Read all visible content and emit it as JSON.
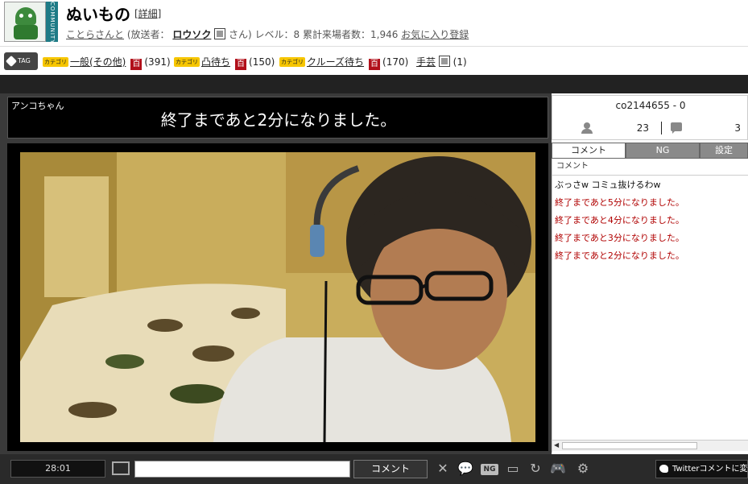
{
  "community": {
    "strip_text": "COMMUNITY",
    "title": "ぬいもの",
    "detail_link": "[詳細]",
    "community_name": "ことらさんと",
    "broadcaster_prefix": "(放送者：",
    "broadcaster_name": "ロウソク",
    "broadcaster_suffix": "さん)",
    "level": "レベル：8",
    "total_visitors": "累計来場者数：1,946",
    "favorite_link": "お気に入り登録"
  },
  "tags": {
    "label": "TAG",
    "items": [
      {
        "badge": "カテゴリ",
        "name": "一般(その他)",
        "dict": "百",
        "count": "(391)"
      },
      {
        "badge": "カテゴリ",
        "name": "凸待ち",
        "dict": "百",
        "count": "(150)"
      },
      {
        "badge": "カテゴリ",
        "name": "クルーズ待ち",
        "dict": "百",
        "count": "(170)"
      },
      {
        "badge": "",
        "name": "手芸",
        "dict": "",
        "count": "(1)"
      }
    ]
  },
  "telop": {
    "name": "アンコちゃん",
    "text": "終了まであと2分になりました。"
  },
  "stream": {
    "live_id": "co2144655 - 0",
    "viewers": "23",
    "comments": "3"
  },
  "tabs": [
    {
      "label": "コメント",
      "active": true
    },
    {
      "label": "NG",
      "active": false
    },
    {
      "label": "設定",
      "active": false
    }
  ],
  "comment_column_header": "コメント",
  "comments": [
    {
      "text": "ぶっさw  コミュ抜けるわw",
      "type": "user"
    },
    {
      "text": "終了まであと5分になりました。",
      "type": "sys"
    },
    {
      "text": "終了まであと4分になりました。",
      "type": "sys"
    },
    {
      "text": "終了まであと3分になりました。",
      "type": "sys"
    },
    {
      "text": "終了まであと2分になりました。",
      "type": "sys"
    }
  ],
  "controls": {
    "time": "28:01",
    "comment_button": "コメント",
    "ng_label": "NG",
    "twitter_button": "Twitterコメントに変更"
  },
  "colors": {
    "system_comment": "#b00000",
    "category_badge": "#f7c600",
    "dict_badge": "#b10f1a",
    "community_strip": "#1e7b86"
  }
}
